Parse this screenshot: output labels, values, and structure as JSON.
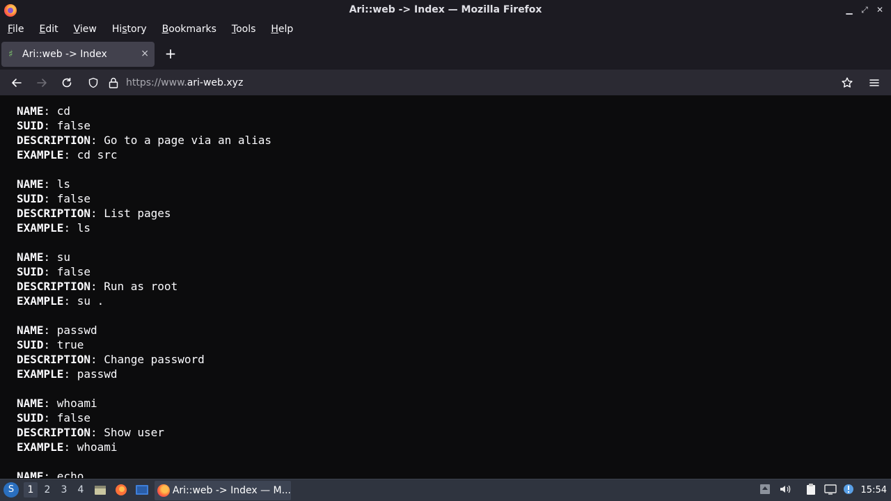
{
  "window": {
    "title": "Ari::web -> Index — Mozilla Firefox"
  },
  "menubar": {
    "items": [
      {
        "label": "File",
        "mnemonic": "F",
        "rest": "ile"
      },
      {
        "label": "Edit",
        "mnemonic": "E",
        "rest": "dit"
      },
      {
        "label": "View",
        "mnemonic": "V",
        "rest": "iew"
      },
      {
        "label": "History",
        "mnemonic": "s",
        "pre": "Hi",
        "rest": "tory"
      },
      {
        "label": "Bookmarks",
        "mnemonic": "B",
        "rest": "ookmarks"
      },
      {
        "label": "Tools",
        "mnemonic": "T",
        "rest": "ools"
      },
      {
        "label": "Help",
        "mnemonic": "H",
        "rest": "elp"
      }
    ]
  },
  "tab": {
    "label": "Ari::web -> Index",
    "close": "×",
    "new_tab": "+"
  },
  "navbar": {
    "url_prefix": "https://www.",
    "url_host": "ari-web.xyz"
  },
  "content": {
    "commands": [
      {
        "name": "cd",
        "suid": "false",
        "description": "Go to a page via an alias",
        "example": "cd src"
      },
      {
        "name": "ls",
        "suid": "false",
        "description": "List pages",
        "example": "ls"
      },
      {
        "name": "su",
        "suid": "false",
        "description": "Run as root",
        "example": "su ."
      },
      {
        "name": "passwd",
        "suid": "true",
        "description": "Change password",
        "example": "passwd"
      },
      {
        "name": "whoami",
        "suid": "false",
        "description": "Show user",
        "example": "whoami"
      },
      {
        "name": "echo",
        "suid": "",
        "description": "",
        "example": ""
      }
    ],
    "keys": {
      "name": "NAME",
      "suid": "SUID",
      "description": "DESCRIPTION",
      "example": "EXAMPLE"
    }
  },
  "taskbar": {
    "workspaces": [
      "1",
      "2",
      "3",
      "4"
    ],
    "active_workspace": "1",
    "task_label": "Ari::web -> Index — M...",
    "clock": "15:54"
  }
}
